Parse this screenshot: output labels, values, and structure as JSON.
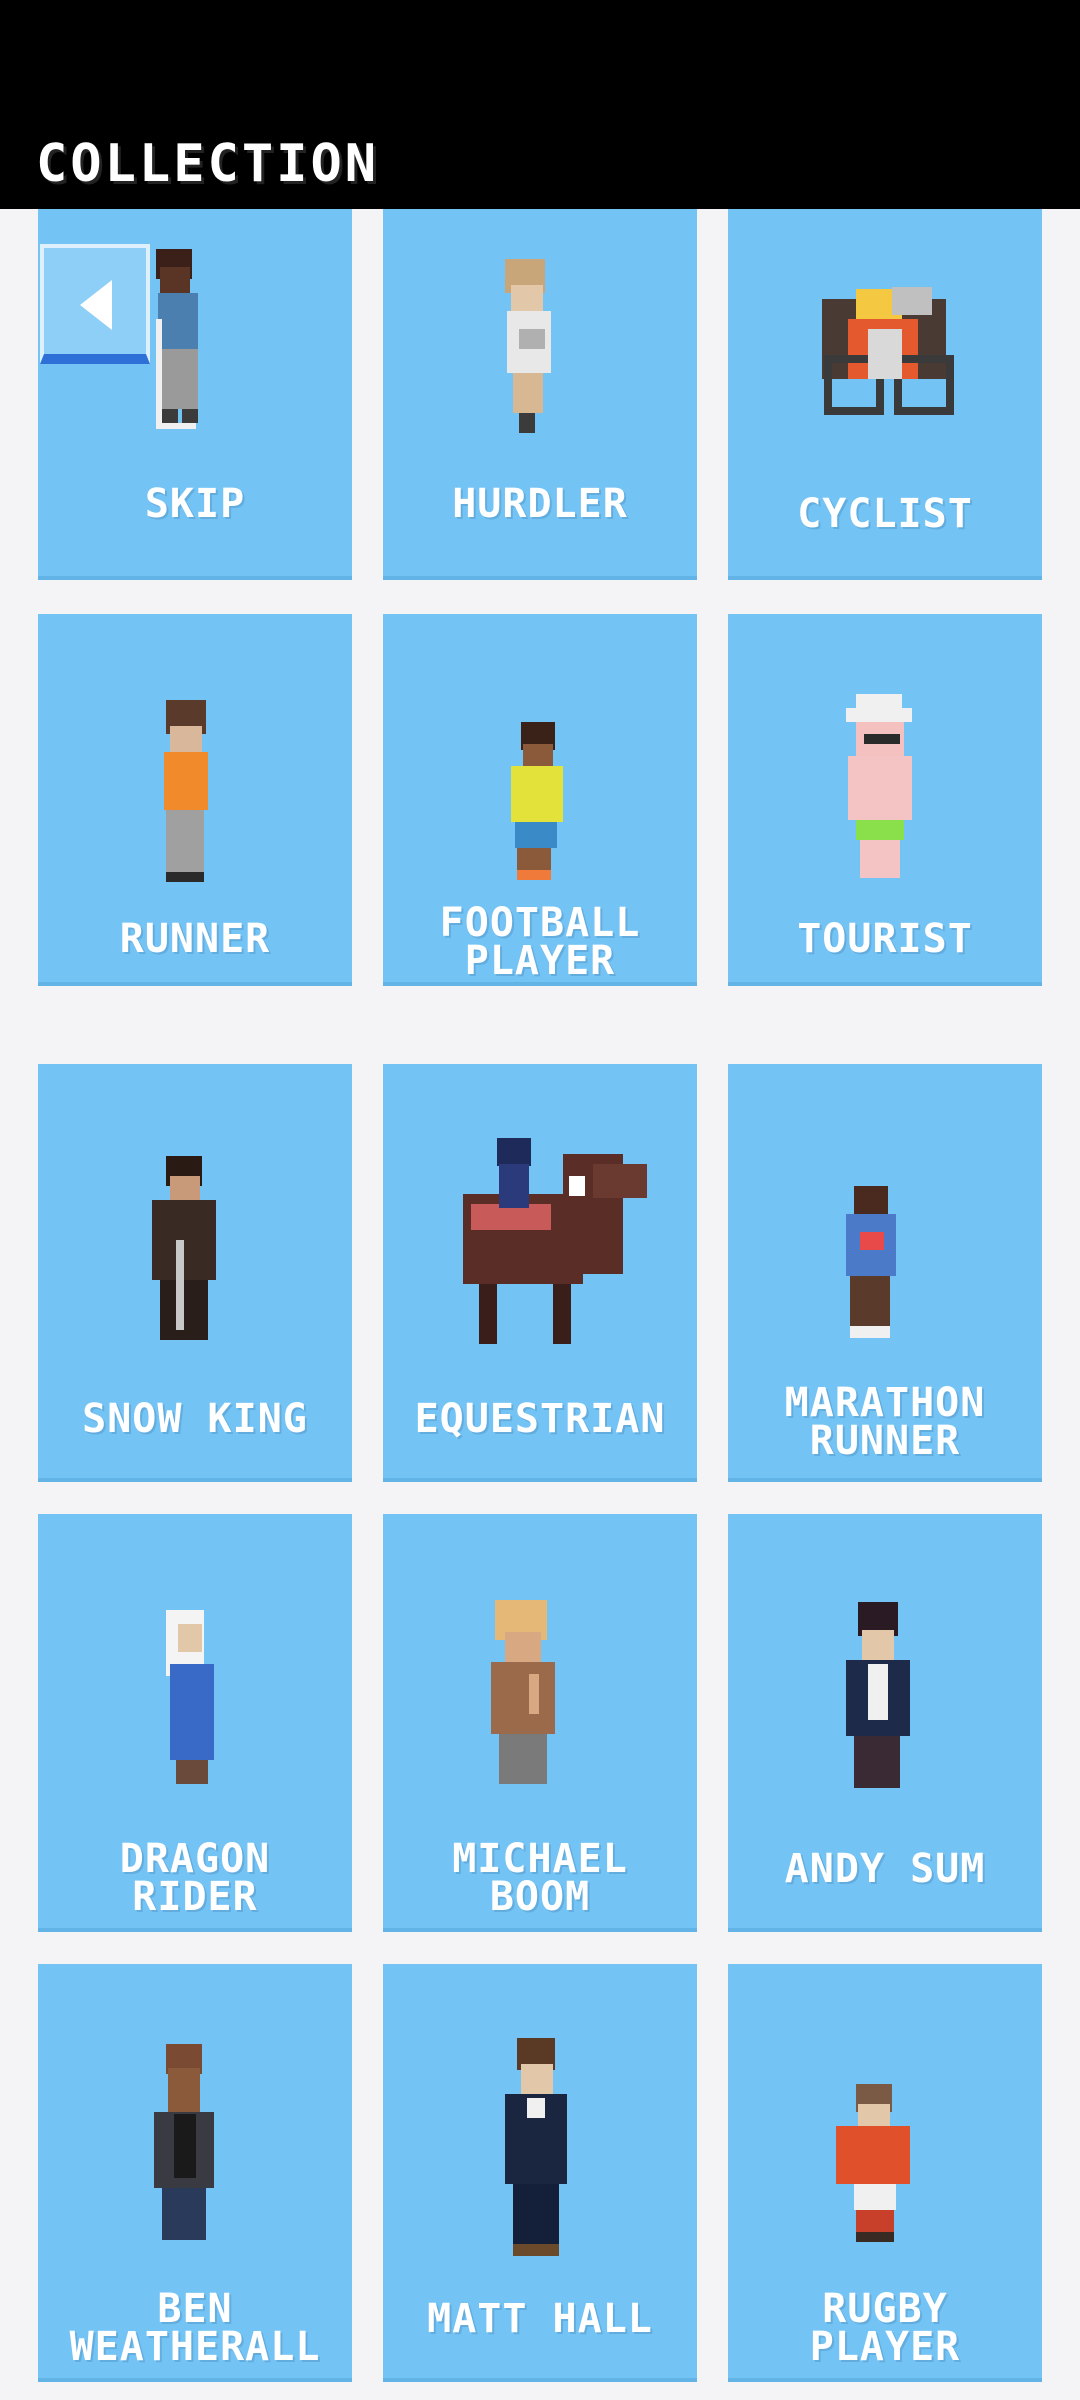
{
  "header": {
    "title": "COLLECTION"
  },
  "back_button": {
    "icon": "back-arrow-icon"
  },
  "characters": [
    {
      "label": "SKIP"
    },
    {
      "label": "HURDLER"
    },
    {
      "label": "CYCLIST"
    },
    {
      "label": "RUNNER"
    },
    {
      "label": "FOOTBALL\nPLAYER"
    },
    {
      "label": "TOURIST"
    },
    {
      "label": "SNOW KING"
    },
    {
      "label": "EQUESTRIAN"
    },
    {
      "label": "MARATHON\nRUNNER"
    },
    {
      "label": "DRAGON\nRIDER"
    },
    {
      "label": "MICHAEL\nBOOM"
    },
    {
      "label": "ANDY SUM"
    },
    {
      "label": "BEN\nWEATHERALL"
    },
    {
      "label": "MATT HALL"
    },
    {
      "label": "RUGBY\nPLAYER"
    }
  ],
  "colors": {
    "card": "#73c3f5",
    "header": "#000000",
    "background": "#f4f4f6",
    "back_accent": "#2f6fd8"
  }
}
